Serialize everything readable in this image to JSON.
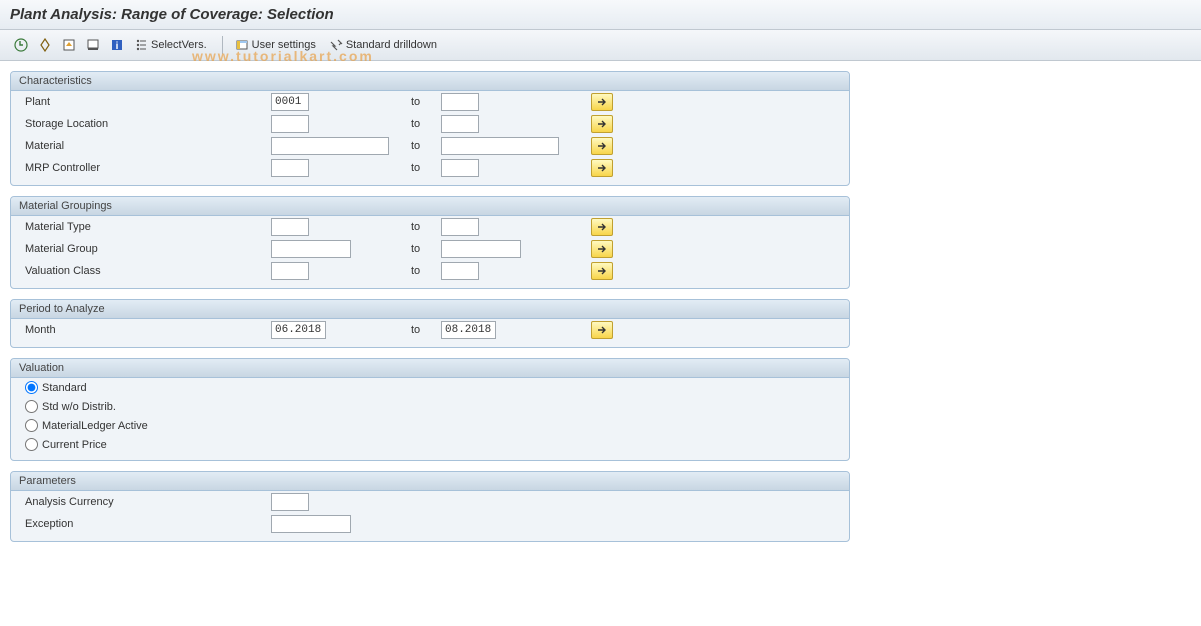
{
  "title": "Plant Analysis: Range of Coverage: Selection",
  "watermark": "www.tutorialkart.com",
  "toolbar": {
    "select_vers": "SelectVers.",
    "user_settings": "User settings",
    "standard_drilldown": "Standard drilldown"
  },
  "to_label": "to",
  "groups": {
    "characteristics": {
      "title": "Characteristics",
      "plant_label": "Plant",
      "plant_from": "0001",
      "plant_to": "",
      "storage_loc_label": "Storage Location",
      "storage_loc_from": "",
      "storage_loc_to": "",
      "material_label": "Material",
      "material_from": "",
      "material_to": "",
      "mrp_label": "MRP Controller",
      "mrp_from": "",
      "mrp_to": ""
    },
    "material_groupings": {
      "title": "Material Groupings",
      "mat_type_label": "Material Type",
      "mat_type_from": "",
      "mat_type_to": "",
      "mat_group_label": "Material Group",
      "mat_group_from": "",
      "mat_group_to": "",
      "val_class_label": "Valuation Class",
      "val_class_from": "",
      "val_class_to": ""
    },
    "period": {
      "title": "Period to Analyze",
      "month_label": "Month",
      "month_from": "06.2018",
      "month_to": "08.2018"
    },
    "valuation": {
      "title": "Valuation",
      "opt_standard": "Standard",
      "opt_std_wo": "Std w/o Distrib.",
      "opt_ml": "MaterialLedger Active",
      "opt_current": "Current Price"
    },
    "parameters": {
      "title": "Parameters",
      "currency_label": "Analysis Currency",
      "exception_label": "Exception"
    }
  }
}
